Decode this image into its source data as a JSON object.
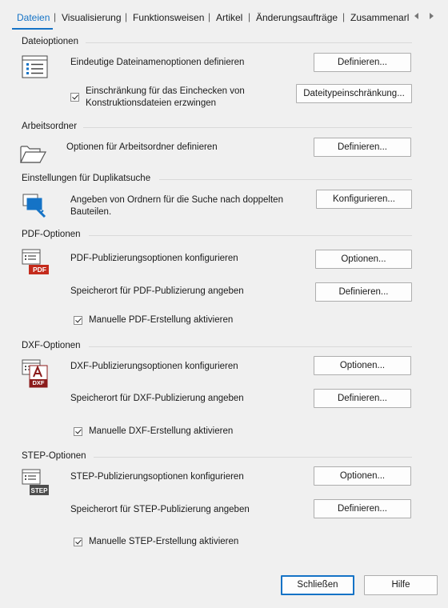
{
  "tabs": [
    {
      "label": "Dateien",
      "active": true
    },
    {
      "label": "Visualisierung"
    },
    {
      "label": "Funktionsweisen"
    },
    {
      "label": "Artikel"
    },
    {
      "label": "Änderungsaufträge"
    },
    {
      "label": "Zusammenarl"
    }
  ],
  "tab_separator": "|",
  "colors": {
    "accent": "#1573c6",
    "pdf_red": "#c42b1c",
    "dxf_red": "#8b1a1a",
    "step_gray": "#4d4d4d"
  },
  "sections": {
    "file_options": {
      "title": "Dateioptionen",
      "row1_label": "Eindeutige Dateinamenoptionen definieren",
      "row1_button": "Definieren...",
      "checkbox_label": "Einschränkung für das Einchecken von Konstruktionsdateien erzwingen",
      "checkbox_checked": true,
      "checkbox_button": "Dateitypeinschränkung...",
      "icon": "list-document-icon"
    },
    "workspace": {
      "title": "Arbeitsordner",
      "label": "Optionen für Arbeitsordner definieren",
      "button": "Definieren...",
      "icon": "folder-icon"
    },
    "duplicates": {
      "title": "Einstellungen für Duplikatsuche",
      "label": "Angeben von Ordnern für die Suche nach doppelten Bauteilen.",
      "button": "Konfigurieren...",
      "icon": "duplicate-search-icon"
    },
    "pdf": {
      "title": "PDF-Optionen",
      "badge": "PDF",
      "row1_label": "PDF-Publizierungsoptionen konfigurieren",
      "row1_button": "Optionen...",
      "row2_label": "Speicherort für PDF-Publizierung angeben",
      "row2_button": "Definieren...",
      "checkbox_label": "Manuelle PDF-Erstellung aktivieren",
      "checkbox_checked": true
    },
    "dxf": {
      "title": "DXF-Optionen",
      "badge": "DXF",
      "row1_label": "DXF-Publizierungsoptionen konfigurieren",
      "row1_button": "Optionen...",
      "row2_label": "Speicherort für DXF-Publizierung angeben",
      "row2_button": "Definieren...",
      "checkbox_label": "Manuelle DXF-Erstellung aktivieren",
      "checkbox_checked": true
    },
    "step": {
      "title": "STEP-Optionen",
      "badge": "STEP",
      "row1_label": "STEP-Publizierungsoptionen konfigurieren",
      "row1_button": "Optionen...",
      "row2_label": "Speicherort für STEP-Publizierung angeben",
      "row2_button": "Definieren...",
      "checkbox_label": "Manuelle STEP-Erstellung aktivieren",
      "checkbox_checked": true
    }
  },
  "footer": {
    "close_button": "Schließen",
    "help_button": "Hilfe"
  }
}
